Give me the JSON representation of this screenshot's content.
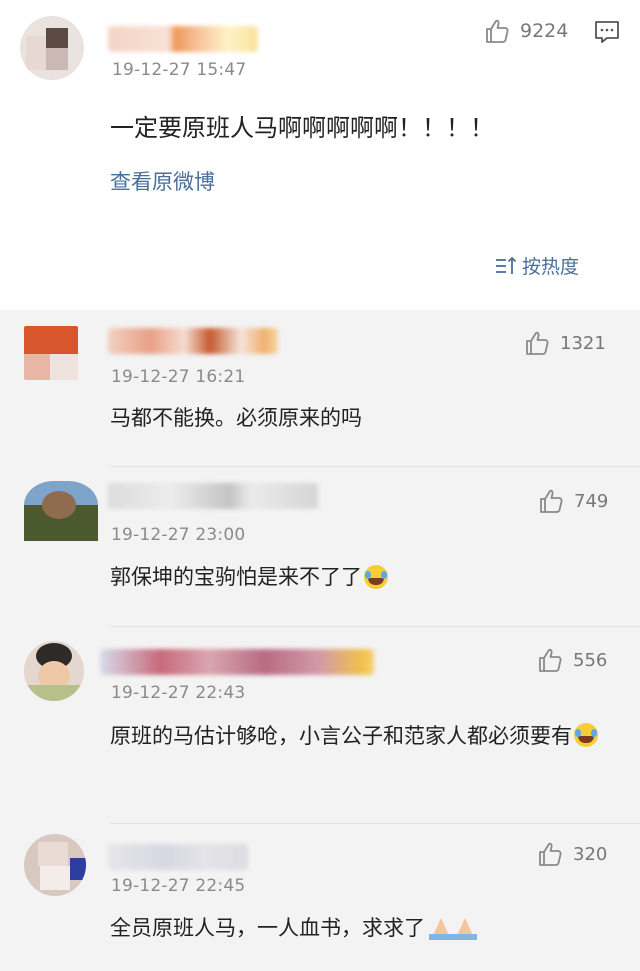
{
  "main_post": {
    "timestamp": "19-12-27 15:47",
    "like_count": "9224",
    "text": "一定要原班人马啊啊啊啊啊！！！！",
    "view_original_label": "查看原微博",
    "sort_label": "按热度",
    "icons": {
      "like": "thumbs-up-icon",
      "comment": "comment-icon",
      "sort": "sort-icon"
    }
  },
  "comments": [
    {
      "timestamp": "19-12-27 16:21",
      "like_count": "1321",
      "text": "马都不能换。必须原来的吗",
      "emoji": ""
    },
    {
      "timestamp": "19-12-27 23:00",
      "like_count": "749",
      "text": "郭保坤的宝驹怕是来不了了",
      "emoji": "laugh-cry-emoji"
    },
    {
      "timestamp": "19-12-27 22:43",
      "like_count": "556",
      "text": "原班的马估计够呛，小言公子和范家人都必须要有",
      "emoji": "laugh-cry-emoji"
    },
    {
      "timestamp": "19-12-27 22:45",
      "like_count": "320",
      "text": "全员原班人马，一人血书，求求了",
      "emoji": "praying-hands-emoji"
    }
  ],
  "colors": {
    "link": "#4a6f99",
    "background": "#f3f3f3",
    "card": "#ffffff",
    "meta": "#8a8a8a"
  }
}
